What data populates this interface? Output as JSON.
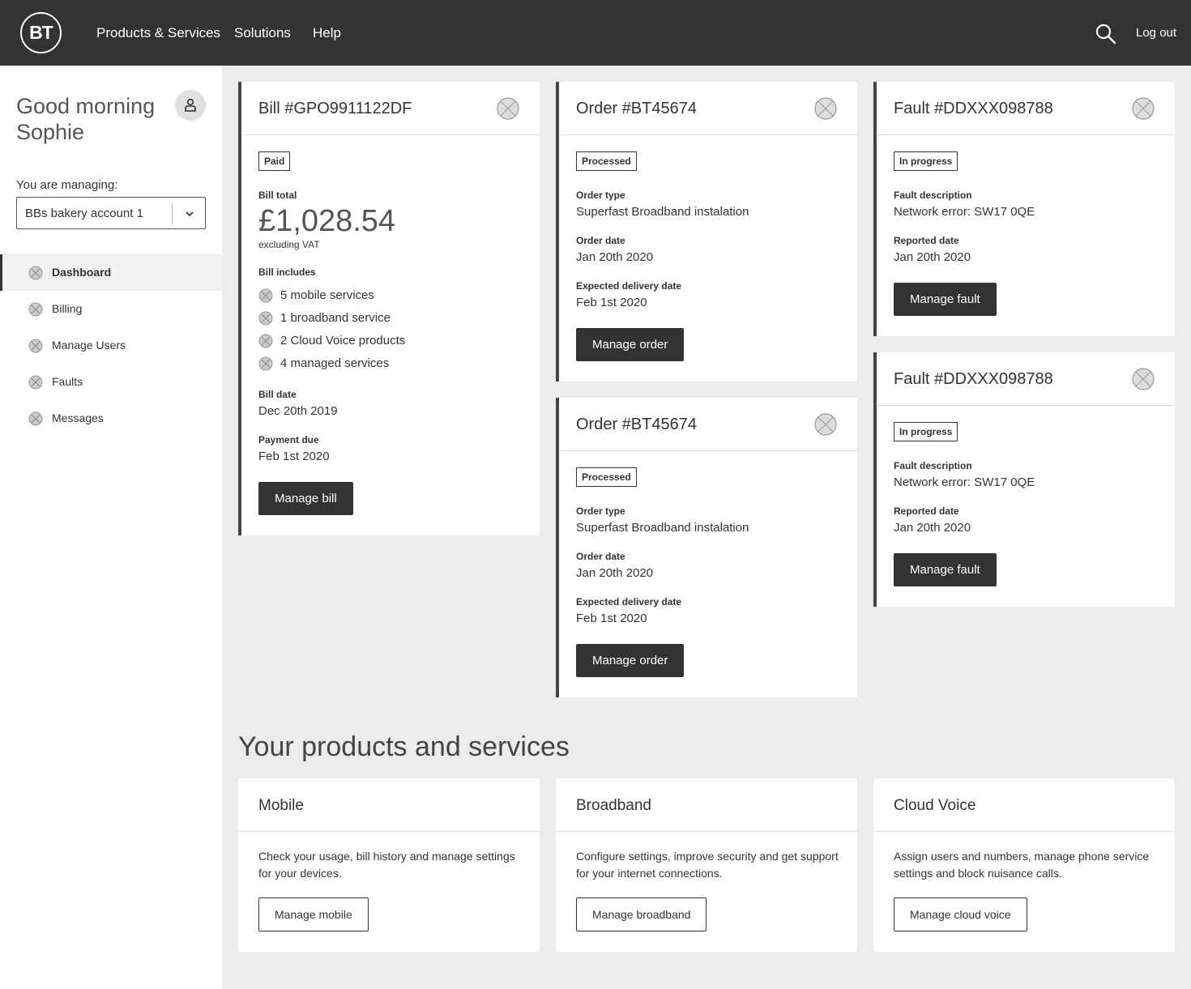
{
  "header": {
    "logo_text": "BT",
    "nav": [
      "Products & Services",
      "Solutions",
      "Help"
    ],
    "logout_label": "Log out"
  },
  "sidebar": {
    "greeting": "Good morning\nSophie",
    "managing_label": "You are managing:",
    "account_selected": "BBs bakery account 1",
    "items": [
      {
        "label": "Dashboard",
        "active": true
      },
      {
        "label": "Billing"
      },
      {
        "label": "Manage Users"
      },
      {
        "label": "Faults"
      },
      {
        "label": "Messages"
      }
    ]
  },
  "bill": {
    "title": "Bill #GPO9911122DF",
    "status": "Paid",
    "total_label": "Bill total",
    "total": "£1,028.54",
    "total_note": "excluding VAT",
    "includes_label": "Bill includes",
    "includes": [
      "5 mobile services",
      "1 broadband service",
      "2 Cloud Voice products",
      "4 managed services"
    ],
    "date_label": "Bill date",
    "date": "Dec 20th 2019",
    "due_label": "Payment due",
    "due": "Feb 1st 2020",
    "button": "Manage bill"
  },
  "orders": [
    {
      "title": "Order #BT45674",
      "status": "Processed",
      "type_label": "Order type",
      "type": "Superfast Broadband instalation",
      "date_label": "Order date",
      "date": "Jan 20th 2020",
      "delivery_label": "Expected delivery date",
      "delivery": "Feb 1st 2020",
      "button": "Manage order"
    },
    {
      "title": "Order #BT45674",
      "status": "Processed",
      "type_label": "Order type",
      "type": "Superfast Broadband instalation",
      "date_label": "Order date",
      "date": "Jan 20th 2020",
      "delivery_label": "Expected delivery date",
      "delivery": "Feb 1st 2020",
      "button": "Manage order"
    }
  ],
  "faults": [
    {
      "title": "Fault #DDXXX098788",
      "status": "In progress",
      "desc_label": "Fault description",
      "desc": "Network error: SW17 0QE",
      "reported_label": "Reported date",
      "reported": "Jan 20th 2020",
      "button": "Manage fault"
    },
    {
      "title": "Fault #DDXXX098788",
      "status": "In progress",
      "desc_label": "Fault description",
      "desc": "Network error: SW17 0QE",
      "reported_label": "Reported date",
      "reported": "Jan 20th 2020",
      "button": "Manage fault"
    }
  ],
  "products": {
    "section_title": "Your products and services",
    "cards": [
      {
        "title": "Mobile",
        "desc": "Check your usage, bill history and manage settings for your devices.",
        "button": "Manage mobile"
      },
      {
        "title": "Broadband",
        "desc": "Configure settings, improve security and get support for your internet connections.",
        "button": "Manage broadband"
      },
      {
        "title": "Cloud Voice",
        "desc": "Assign users and numbers, manage phone service settings and block nuisance calls.",
        "button": "Manage cloud voice"
      }
    ]
  },
  "icons": {
    "placeholder": "placeholder-x-icon",
    "search": "search-icon",
    "user": "user-icon",
    "chevron": "chevron-down-icon"
  }
}
